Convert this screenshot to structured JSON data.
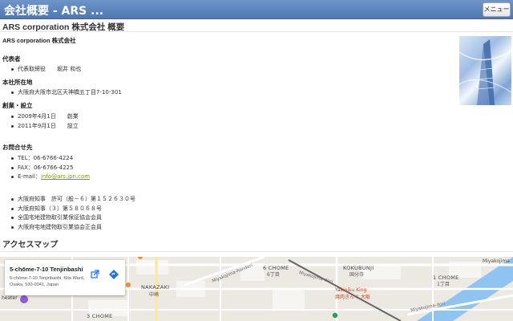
{
  "header": {
    "title": "会社概要 - ARS ...",
    "menu_label": "メニュー"
  },
  "page": {
    "title": "ARS corporation 株式会社 概要",
    "company_name": "ARS corporation 株式会社"
  },
  "representative": {
    "label": "代表者",
    "role": "代表取締役",
    "name": "堀井 和也"
  },
  "headquarters": {
    "label": "本社所在地",
    "address": "大阪府大阪市北区天神橋五丁目7-10-301"
  },
  "founding": {
    "label": "創業・設立",
    "items": [
      {
        "date": "2009年4月1日",
        "event": "創業"
      },
      {
        "date": "2011年9月1日",
        "event": "設立"
      }
    ]
  },
  "contact": {
    "label": "お問合せ先",
    "tel": "TEL：06-6766-4224",
    "fax": "FAX：06-6766-4225",
    "email_label": "E-mail：",
    "email": "info@ars.jpn.com"
  },
  "licenses": [
    "大阪府知事　許可（般－６）第１５２６３０号",
    "大阪府知事（３）第５８０６８号",
    "全国宅地建物取引業保証協会会員",
    "大阪府宅地建物取引業協会正会員"
  ],
  "access": {
    "title": "アクセスマップ"
  },
  "map": {
    "card_title": "5-chōme-7-10 Tenjinbashi",
    "card_address": "5-chōme-7-10 Tenjinbashi, Kita Ward, Osaka, 530-0041, Japan",
    "labels": {
      "kokubunji": "KOKUBUNJI",
      "kokubunji_jp": "国分寺",
      "nakazaki": "NAKAZAKI",
      "nakazaki_jp": "中崎",
      "chome6": "6 CHOME",
      "chome6_jp": "6丁目",
      "chome1": "1 CHOME",
      "chome1_jp": "1丁目",
      "chome3": "3 CHOME",
      "miyakojima1": "Miyakojima-hondori",
      "miyakojima2": "Miyakojima-dori",
      "miyakojima3": "Miyakojima-dori",
      "miyakojima_ku": "Miyakojima",
      "yakiniku": "Yakiniku King",
      "yakiniku_jp": "焼肉きんぐ 大阪",
      "theater": "heater"
    }
  }
}
